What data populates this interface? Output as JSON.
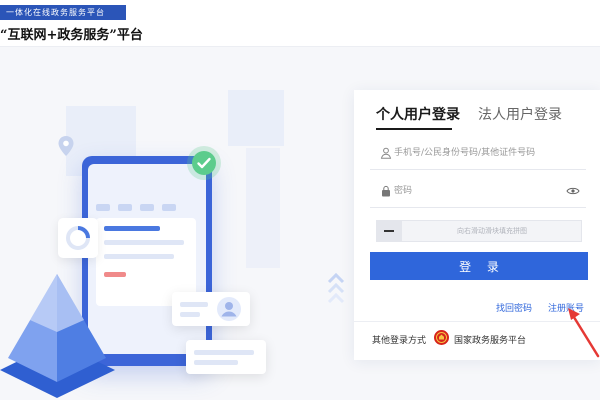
{
  "header": {
    "tagline": "一体化在线政务服务平台",
    "platform_name": "“互联网+政务服务”平台"
  },
  "login": {
    "tabs": [
      {
        "label": "个人用户登录",
        "active": true
      },
      {
        "label": "法人用户登录",
        "active": false
      }
    ],
    "username_placeholder": "手机号/公民身份号码/其他证件号码",
    "password_placeholder": "密码",
    "slider_text": "向右滑动滑块填充拼图",
    "login_button": "登 录",
    "forgot_password": "找回密码",
    "register": "注册账号",
    "other_methods_label": "其他登录方式",
    "gov_platform": "国家政务服务平台"
  },
  "colors": {
    "brand_blue": "#2f66db",
    "header_blue": "#2b55b8",
    "emblem_red": "#d7241b",
    "annotation_red": "#e53935"
  },
  "icons": [
    "user-icon",
    "lock-icon",
    "eye-icon",
    "national-emblem-icon",
    "checkmark-icon",
    "location-pin-icon",
    "avatar-icon",
    "chevron-up-icon"
  ]
}
